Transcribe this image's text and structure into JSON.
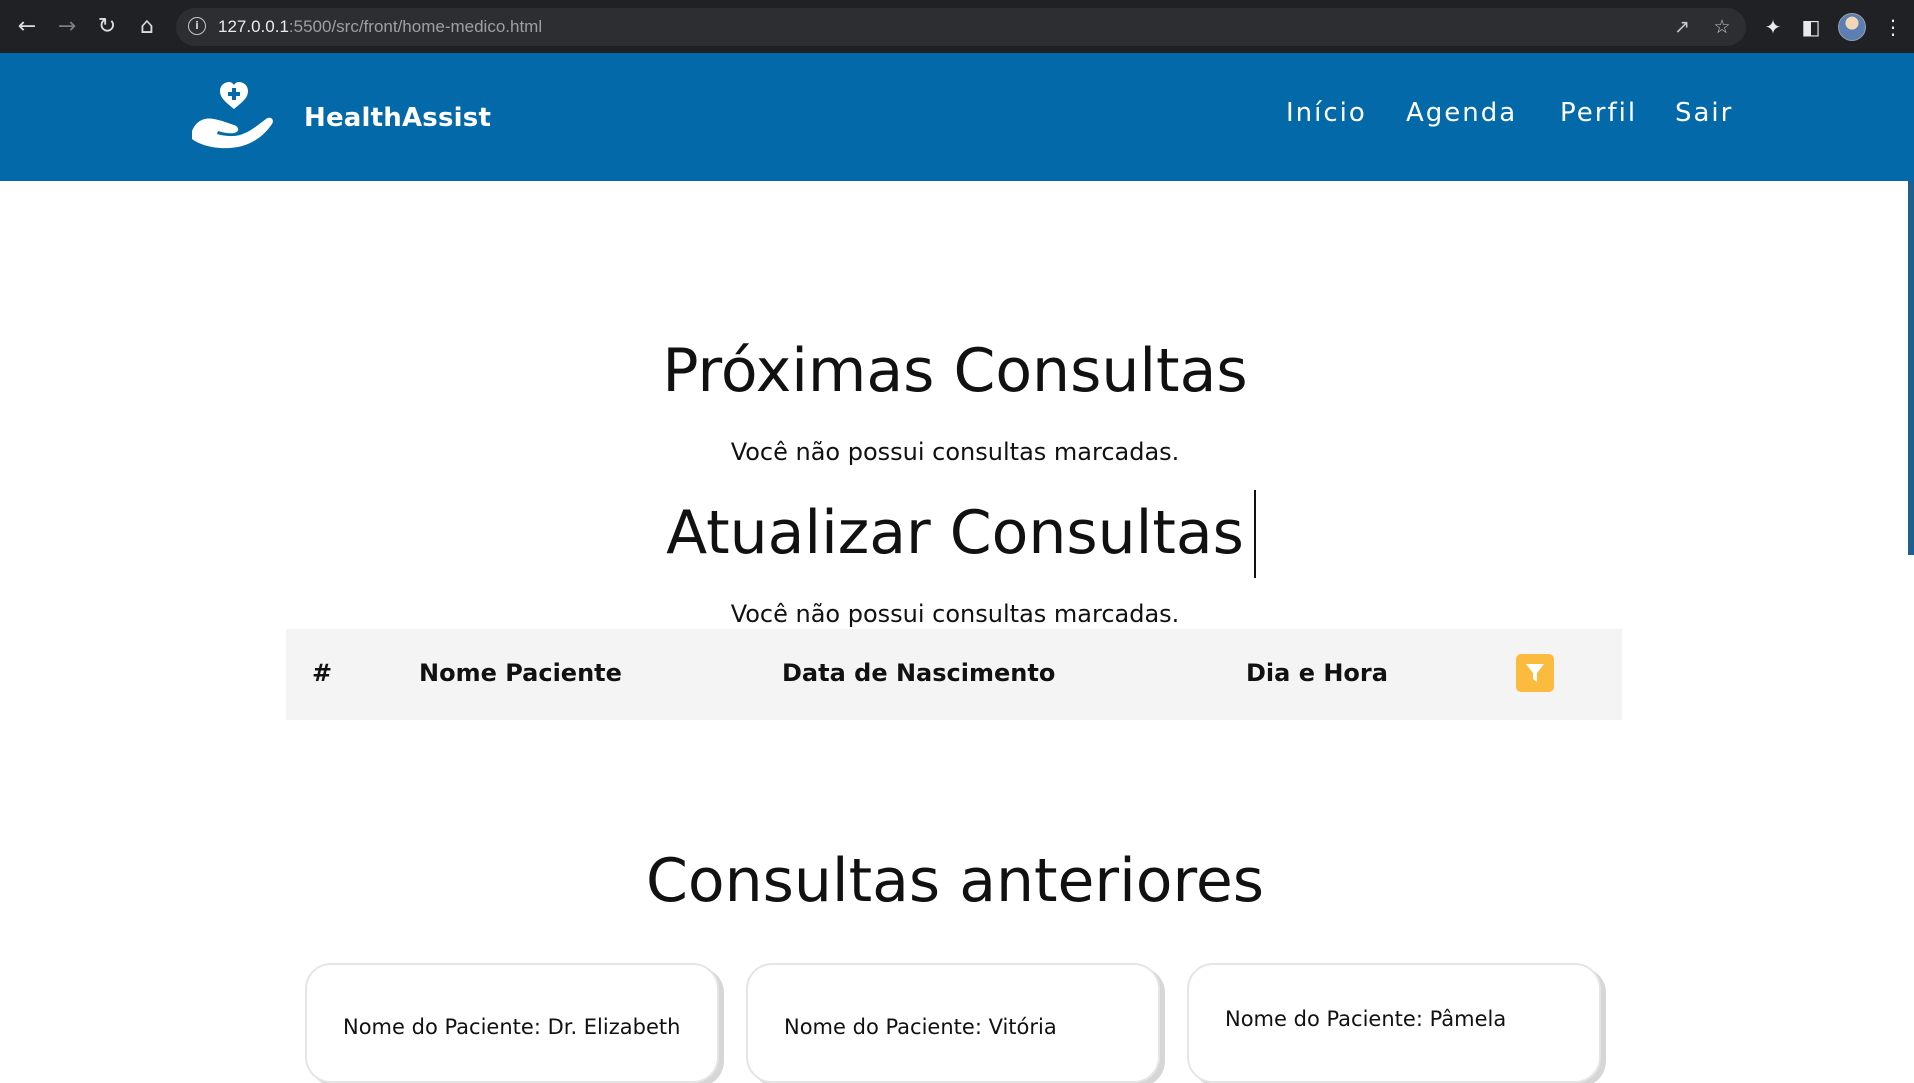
{
  "browser": {
    "url_host": "127.0.0.1",
    "url_rest": ":5500/src/front/home-medico.html",
    "icons": {
      "back": "arrow-left-icon",
      "forward": "arrow-right-icon",
      "reload": "reload-icon",
      "home": "home-icon",
      "site_info": "info-icon",
      "share": "share-icon",
      "bookmark": "star-icon",
      "extensions": "puzzle-icon",
      "side_panel": "side-panel-icon",
      "menu": "kebab-menu-icon"
    }
  },
  "header": {
    "brand": "HealthAssist",
    "nav": [
      "Início",
      "Agenda",
      "Perfil",
      "Sair"
    ],
    "color": "#0469a8"
  },
  "upcoming": {
    "title": "Próximas Consultas",
    "empty_message": "Você não possui consultas marcadas."
  },
  "update": {
    "title": "Atualizar Consultas",
    "empty_message": "Você não possui consultas marcadas.",
    "columns": [
      "#",
      "Nome Paciente",
      "Data de Nascimento",
      "Dia e Hora"
    ],
    "filter_icon": "filter-icon",
    "filter_color": "#fbbb3f"
  },
  "past": {
    "title": "Consultas anteriores",
    "cards": [
      {
        "patient": "Nome do Paciente: Dr. Elizabeth"
      },
      {
        "patient": "Nome do Paciente: Vitória"
      },
      {
        "patient": "Nome do Paciente: Pâmela"
      }
    ]
  }
}
